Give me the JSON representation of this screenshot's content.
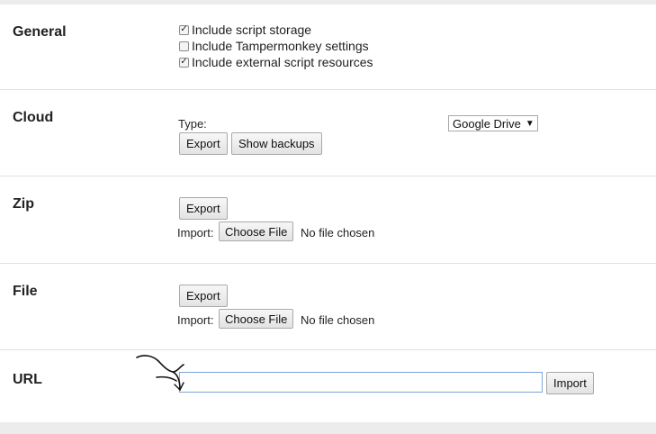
{
  "sections": {
    "general": {
      "title": "General",
      "options": [
        {
          "label": "Include script storage",
          "checked": true
        },
        {
          "label": "Include Tampermonkey settings",
          "checked": false
        },
        {
          "label": "Include external script resources",
          "checked": true
        }
      ]
    },
    "cloud": {
      "title": "Cloud",
      "type_label": "Type:",
      "type_value": "Google Drive",
      "export_label": "Export",
      "show_backups_label": "Show backups"
    },
    "zip": {
      "title": "Zip",
      "export_label": "Export",
      "import_label": "Import:",
      "choose_file_label": "Choose File",
      "file_status": "No file chosen"
    },
    "file": {
      "title": "File",
      "export_label": "Export",
      "import_label": "Import:",
      "choose_file_label": "Choose File",
      "file_status": "No file chosen"
    },
    "url": {
      "title": "URL",
      "input_value": "",
      "import_label": "Import"
    }
  },
  "icons": {
    "checkbox_checked": "check-icon",
    "dropdown": "dropdown-arrow-icon",
    "annotation": "hand-drawn-arrow-icon"
  },
  "colors": {
    "focus_border": "#7aa7d8",
    "page_background": "#ececec"
  }
}
